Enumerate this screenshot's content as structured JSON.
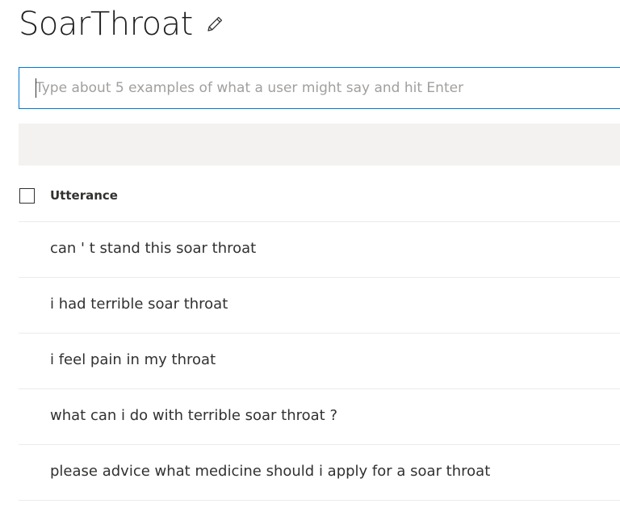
{
  "intent": {
    "name": "SoarThroat",
    "edit_icon": "pencil-icon"
  },
  "input": {
    "placeholder": "Type about 5 examples of what a user might say and hit Enter",
    "value": ""
  },
  "table": {
    "select_all_icon": "checkbox-icon",
    "column_header": "Utterance",
    "rows": [
      "can ' t stand this soar throat",
      "i had terrible soar throat",
      "i feel pain in my throat",
      "what can i do with terrible soar throat ?",
      "please advice what medicine should i apply for a soar throat"
    ]
  },
  "colors": {
    "accent": "#0078d4",
    "band": "#f3f2f1",
    "text": "#323130",
    "placeholder": "#a19f9d"
  }
}
